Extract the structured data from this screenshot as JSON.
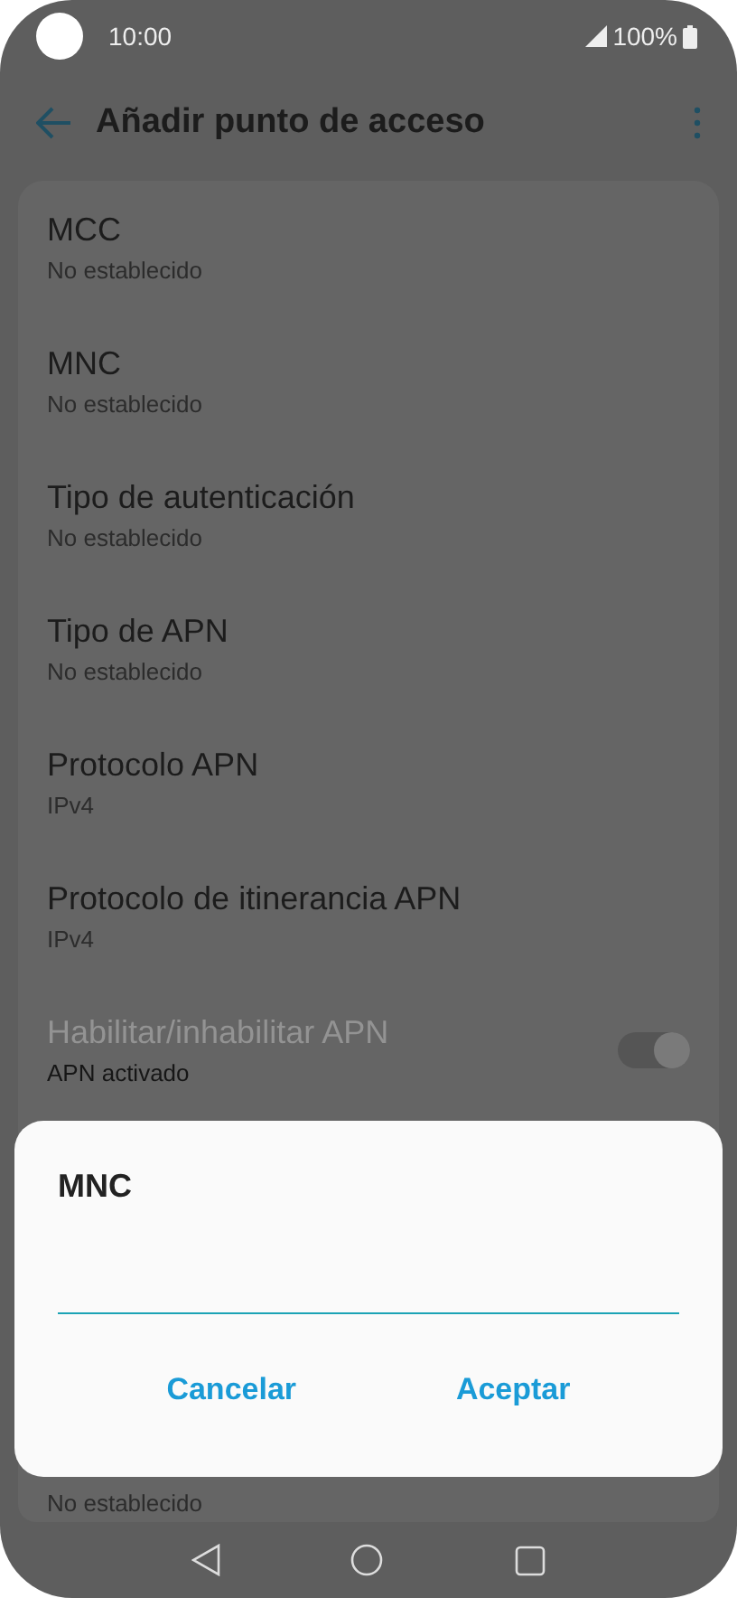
{
  "status_bar": {
    "time": "10:00",
    "battery": "100%"
  },
  "app_bar": {
    "title": "Añadir punto de acceso"
  },
  "settings": [
    {
      "kind": "text",
      "title": "MCC",
      "subtitle": "No establecido",
      "disabled": false
    },
    {
      "kind": "text",
      "title": "MNC",
      "subtitle": "No establecido",
      "disabled": false
    },
    {
      "kind": "text",
      "title": "Tipo de autenticación",
      "subtitle": "No establecido",
      "disabled": false
    },
    {
      "kind": "text",
      "title": "Tipo de APN",
      "subtitle": "No establecido",
      "disabled": false
    },
    {
      "kind": "text",
      "title": "Protocolo APN",
      "subtitle": "IPv4",
      "disabled": false
    },
    {
      "kind": "text",
      "title": "Protocolo de itinerancia APN",
      "subtitle": "IPv4",
      "disabled": false
    },
    {
      "kind": "toggle",
      "title": "Habilitar/inhabilitar APN",
      "subtitle": "APN activado",
      "disabled": true,
      "on": true
    },
    {
      "kind": "text",
      "subtitle": "No establecido",
      "disabled": false
    }
  ],
  "dialog": {
    "title": "MNC",
    "buttons": [
      "Cancelar",
      "Aceptar"
    ]
  }
}
